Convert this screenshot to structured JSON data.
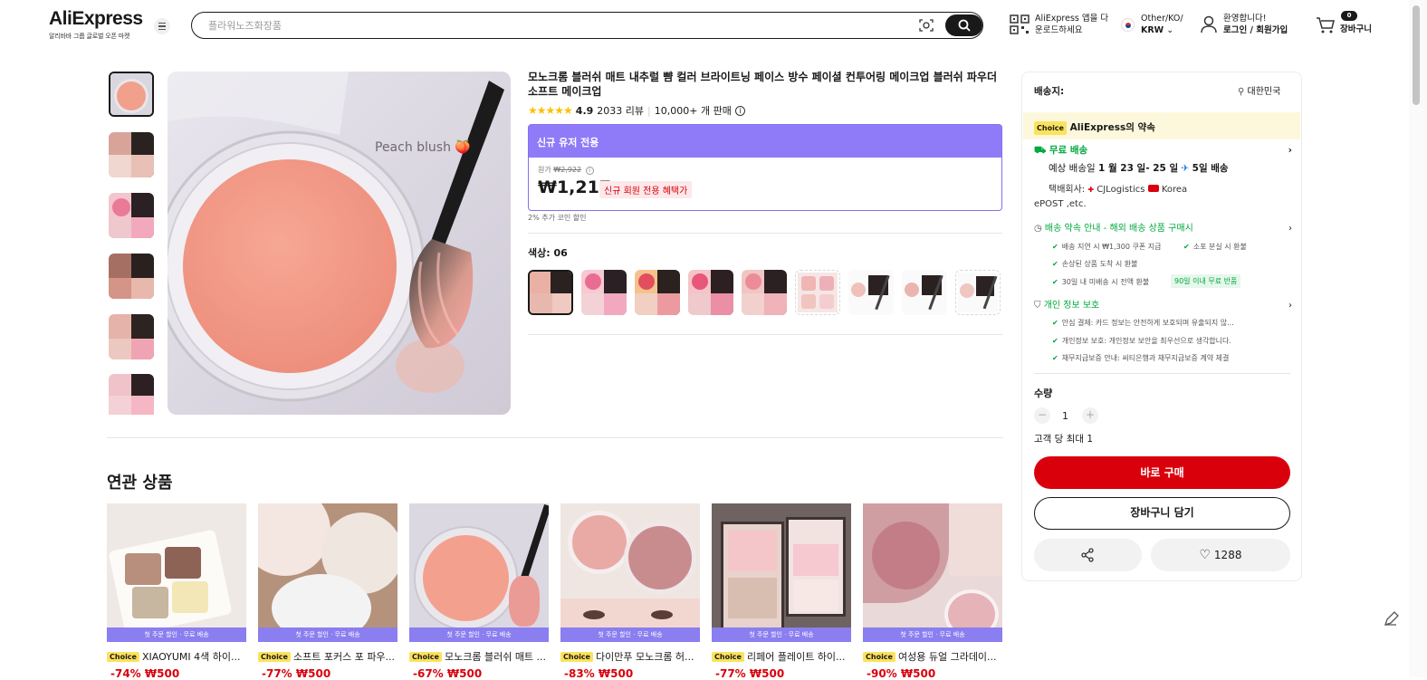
{
  "header": {
    "logo": "AliExpress",
    "logo_sub": "알리바바 그룹 글로벌 오픈 마켓",
    "search_placeholder": "플라워노즈화장품",
    "app_download": [
      "AliExpress 앱을 다",
      "운로드하세요"
    ],
    "locale_top": "Other/KO/",
    "locale_currency": "KRW",
    "greeting": "환영합니다!",
    "login": "로그인 / 회원가입",
    "cart_count": "0",
    "cart_label": "장바구니"
  },
  "product": {
    "title": "모노크롬 블러쉬 매트 내추럴 뺨 컬러 브라이트닝 페이스 방수 페이셜 컨투어링 메이크업 블러쉬 파우더 소프트 메이크업",
    "rating": "4.9",
    "reviews": "2033 리뷰",
    "sold": "10,000+ 개 판매",
    "image_caption": "Peach blush 🍑",
    "promo_header": "신규 유저 전용",
    "original_price_label": "원가",
    "original_price": "₩2,922",
    "price": "₩1,217",
    "price_tag": "신규 회원 전용 혜택가",
    "coin_discount": "2% 추가 코인 할인",
    "color_label": "색상: 06"
  },
  "related": {
    "title": "연관 상품",
    "ribbon": "첫 주문 할인 · 무료 배송",
    "choice": "Choice",
    "items": [
      {
        "name": "XIAOYUMI 4색 하이...",
        "price": "-74% ₩500"
      },
      {
        "name": "소프트 포커스 포 파우...",
        "price": "-77% ₩500"
      },
      {
        "name": "모노크롬 블러쉬 매트 ...",
        "price": "-67% ₩500"
      },
      {
        "name": "다이만푸 모노크롬 허...",
        "price": "-83% ₩500"
      },
      {
        "name": "리페어 플레이트 하이...",
        "price": "-77% ₩500"
      },
      {
        "name": "여성용 듀얼 그라데이...",
        "price": "-90% ₩500"
      }
    ]
  },
  "panel": {
    "ship_to_label": "배송지:",
    "ship_to_value": "대한민국",
    "choice_badge": "Choice",
    "promise": "AliExpress의 약속",
    "free_shipping": "무료 배송",
    "eta_prefix": "예상 배송일",
    "eta_range": "1 월 23 일- 25 일",
    "eta_fast": "5일 배송",
    "carrier_label": "택배회사:",
    "carrier_1": "CJLogistics",
    "carrier_2": "Korea",
    "carrier_3": "ePOST ,etc.",
    "delivery_guide": "배송 약속 안내 - 해외 배송 상품 구매시",
    "delivery_items": [
      "배송 지연 시 ₩1,300 쿠폰 지급",
      "소포 분실 시 환불",
      "손상된 상품 도착 시 환불",
      "30일 내 미배송 시 전액 환불"
    ],
    "return_badge": "90일 이내 무료 반품",
    "privacy": "개인 정보 보호",
    "privacy_items": [
      "안심 결제: 카드 정보는 안전하게 보호되며 유출되지 않...",
      "개인정보 보호: 개인정보 보안을 최우선으로 생각합니다.",
      "채무지급보증 안내: 씨티은행과 채무지급보증 계약 체결"
    ],
    "qty_label": "수량",
    "qty_value": "1",
    "qty_limit": "고객 당 최대 1",
    "buy_now": "바로 구매",
    "add_cart": "장바구니 담기",
    "wishlist_count": "1288"
  },
  "colors": {
    "accent_red": "#d9000c",
    "promo_purple": "#8f7bf7",
    "choice_yellow": "#fbe25c",
    "green": "#00a83e"
  }
}
